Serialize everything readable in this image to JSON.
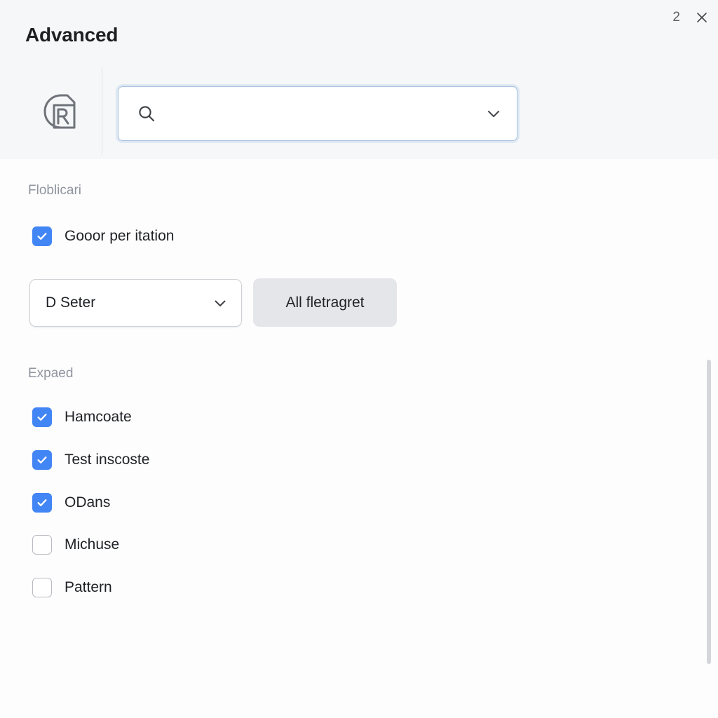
{
  "window": {
    "title": "Advanced",
    "count_badge": "2",
    "close_icon": "close-icon"
  },
  "header": {
    "doc_icon": "document-r-icon",
    "search": {
      "icon": "search-icon",
      "value": "",
      "placeholder": "",
      "chevron_icon": "chevron-down-icon"
    }
  },
  "sections": [
    {
      "label": "Floblicari",
      "checkboxes": [
        {
          "label": "Gooor per itation",
          "checked": true
        }
      ]
    },
    {
      "label": "Expaed",
      "checkboxes": [
        {
          "label": "Hamcoate",
          "checked": true
        },
        {
          "label": "Test inscoste",
          "checked": true
        },
        {
          "label": "ODans",
          "checked": true
        },
        {
          "label": "Michuse",
          "checked": false
        },
        {
          "label": "Pattern",
          "checked": false
        }
      ]
    }
  ],
  "controls": {
    "select": {
      "value": "D Seter",
      "chevron_icon": "chevron-down-icon"
    },
    "action_button": {
      "label": "All fletragret"
    }
  },
  "colors": {
    "accent": "#4285f4",
    "header_bg": "#f6f7f9",
    "body_bg": "#fdfdfd",
    "button_bg": "#e4e6e9",
    "focus_border": "#a8c3e0",
    "muted_text": "#9095a0"
  }
}
